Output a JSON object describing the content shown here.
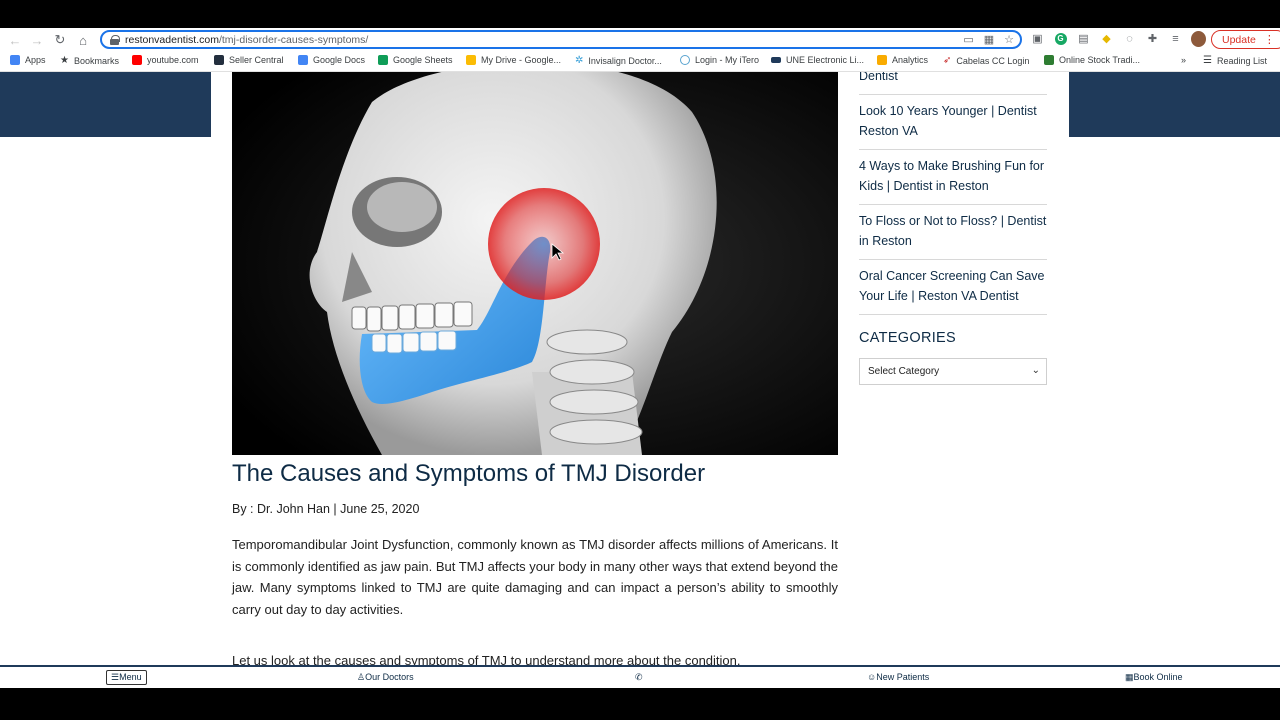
{
  "browser": {
    "url_domain": "restonvadentist.com",
    "url_path": "/tmj-disorder-causes-symptoms/",
    "update_label": "Update"
  },
  "bookmarks": [
    {
      "label": "Apps",
      "icon": "apps-grid-icon",
      "color": "#4285f4"
    },
    {
      "label": "Bookmarks",
      "icon": "star-icon",
      "color": "#202124"
    },
    {
      "label": "youtube.com",
      "icon": "youtube-icon",
      "color": "#ff0000"
    },
    {
      "label": "Seller Central",
      "icon": "amazon-icon",
      "color": "#232f3e"
    },
    {
      "label": "Google Docs",
      "icon": "docs-icon",
      "color": "#4285f4"
    },
    {
      "label": "Google Sheets",
      "icon": "sheets-icon",
      "color": "#0f9d58"
    },
    {
      "label": "My Drive - Google...",
      "icon": "drive-icon",
      "color": "#fbbc04"
    },
    {
      "label": "Invisalign Doctor...",
      "icon": "invisalign-icon",
      "color": "#3aa0d8"
    },
    {
      "label": "Login - My iTero",
      "icon": "itero-icon",
      "color": "#5aa4d0"
    },
    {
      "label": "UNE Electronic Li...",
      "icon": "une-icon",
      "color": "#1f3a5a"
    },
    {
      "label": "Analytics",
      "icon": "analytics-icon",
      "color": "#f9ab00"
    },
    {
      "label": "Cabelas CC Login",
      "icon": "cabelas-icon",
      "color": "#c62828"
    },
    {
      "label": "Online Stock Tradi...",
      "icon": "td-icon",
      "color": "#2e7d32"
    },
    {
      "label": "»",
      "icon": "overflow-icon",
      "color": "#5f6368"
    },
    {
      "label": "Reading List",
      "icon": "reading-list-icon",
      "color": "#5f6368"
    }
  ],
  "sidebar": {
    "items": [
      {
        "label": "Dentist"
      },
      {
        "label": "Look 10 Years Younger | Dentist Reston VA"
      },
      {
        "label": "4 Ways to Make Brushing Fun for Kids | Dentist in Reston"
      },
      {
        "label": "To Floss or Not to Floss? | Dentist in Reston"
      },
      {
        "label": "Oral Cancer Screening Can Save Your Life | Reston VA Dentist"
      }
    ],
    "categories_title": "CATEGORIES",
    "select_value": "Select Category"
  },
  "article": {
    "title": "The Causes and Symptoms of TMJ Disorder",
    "byline": "By : Dr. John Han | June 25, 2020",
    "paragraph1": "Temporomandibular Joint Dysfunction, commonly known as TMJ disorder affects millions of Americans. It is commonly identified as jaw pain. But TMJ affects your body in many other ways that extend beyond the jaw.  Many symptoms linked to TMJ are quite damaging and can impact a person’s ability to smoothly carry out day to day activities.",
    "paragraph2": "Let us look at the causes and symptoms of TMJ to understand more about the condition."
  },
  "bottom_nav": {
    "menu": "☰Menu",
    "doctors": "Our Doctors",
    "new_patients": "New Patients",
    "book": "Book Online"
  },
  "colors": {
    "navy": "#1f3a5a",
    "title": "#0e2b45",
    "jaw_blue": "#3b9be8",
    "pain_red": "#e02020"
  }
}
